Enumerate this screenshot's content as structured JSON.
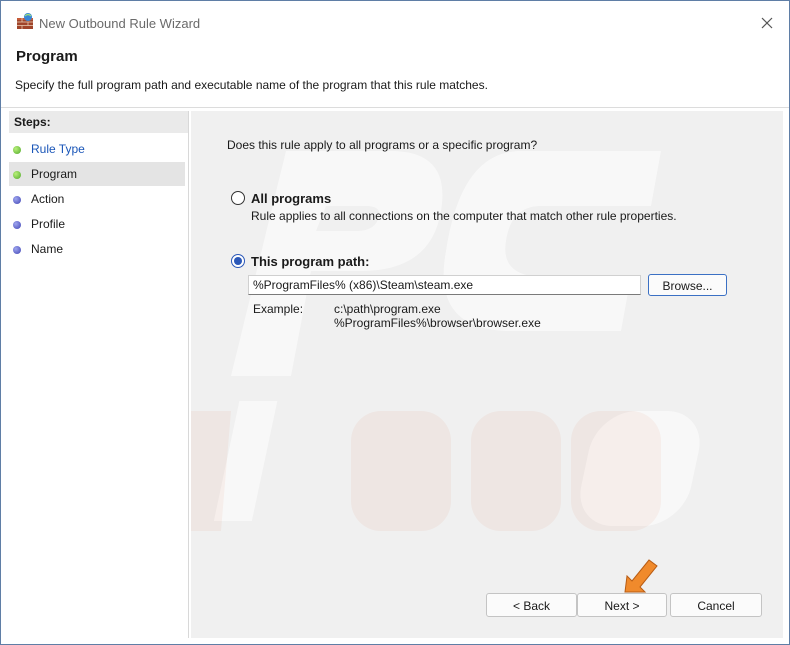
{
  "window": {
    "title": "New Outbound Rule Wizard"
  },
  "header": {
    "title": "Program",
    "description": "Specify the full program path and executable name of the program that this rule matches."
  },
  "steps": {
    "heading": "Steps:",
    "items": [
      {
        "label": "Rule Type",
        "status": "completed",
        "link": true
      },
      {
        "label": "Program",
        "status": "current",
        "selected": true
      },
      {
        "label": "Action",
        "status": "pending"
      },
      {
        "label": "Profile",
        "status": "pending"
      },
      {
        "label": "Name",
        "status": "pending"
      }
    ]
  },
  "content": {
    "question": "Does this rule apply to all programs or a specific program?",
    "options": {
      "all_programs": {
        "label": "All programs",
        "description": "Rule applies to all connections on the computer that match other rule properties.",
        "checked": false
      },
      "program_path": {
        "label": "This program path:",
        "checked": true,
        "value": "%ProgramFiles% (x86)\\Steam\\steam.exe"
      }
    },
    "browse_label": "Browse...",
    "example_label": "Example:",
    "example_line1": "c:\\path\\program.exe",
    "example_line2": "%ProgramFiles%\\browser\\browser.exe"
  },
  "footer": {
    "back_label": "< Back",
    "next_label": "Next >",
    "cancel_label": "Cancel"
  },
  "colors": {
    "accent": "#2b58b8",
    "link": "#1a56b8",
    "annotation_arrow": "#f08a2c",
    "watermark": "#e07b4a"
  },
  "icons": {
    "app": "firewall-wall-icon",
    "close": "close-icon",
    "step_done": "green-bullet-icon",
    "step_pending": "blue-bullet-icon",
    "annotation": "arrow-pointer-icon"
  }
}
